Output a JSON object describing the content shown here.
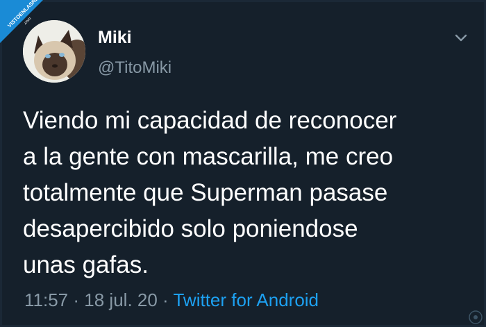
{
  "watermark": {
    "text": "VISTOENLASREDES .com"
  },
  "tweet": {
    "author": {
      "name": "Miki",
      "handle": "@TitoMiki",
      "avatar": "siamese-cat-avatar"
    },
    "text_lines": [
      "Viendo mi capacidad de reconocer",
      "a la gente con mascarilla, me creo",
      "totalmente que Superman pasase",
      "desapercibido solo poniendose",
      "unas gafas."
    ],
    "time": "11:57",
    "date": "18 jul. 20",
    "separator": "·",
    "source": "Twitter for Android",
    "menu_icon": "chevron-down-icon"
  },
  "colors": {
    "background": "#15202b",
    "text_primary": "#ffffff",
    "text_secondary": "#8899a6",
    "link": "#1da1f2"
  }
}
